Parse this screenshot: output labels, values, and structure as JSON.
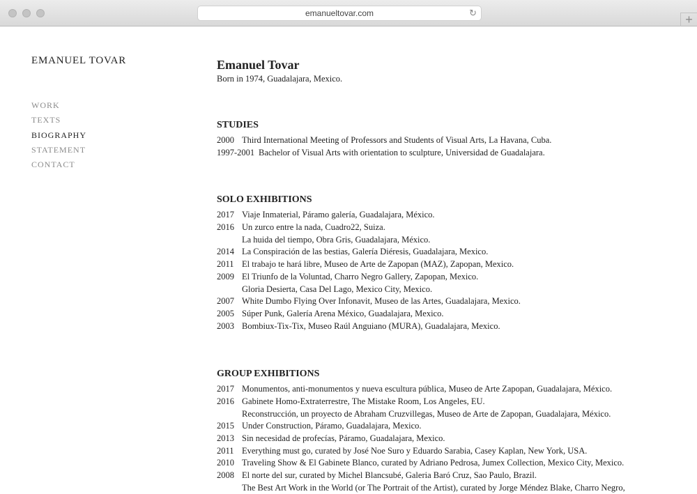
{
  "browser": {
    "url": "emanueltovar.com",
    "reload_icon": "↻",
    "new_tab_icon": "+"
  },
  "site": {
    "title": "EMANUEL TOVAR"
  },
  "nav": [
    {
      "label": "WORK",
      "active": false
    },
    {
      "label": "TEXTS",
      "active": false
    },
    {
      "label": "BIOGRAPHY",
      "active": true
    },
    {
      "label": "STATEMENT",
      "active": false
    },
    {
      "label": "CONTACT",
      "active": false
    }
  ],
  "bio": {
    "name": "Emanuel Tovar",
    "born": "Born in 1974, Guadalajara, Mexico."
  },
  "studies": {
    "title": "STUDIES",
    "entries": [
      {
        "year": "2000",
        "text": "Third International Meeting of Professors and Students of Visual Arts, La Havana, Cuba."
      },
      {
        "year": "1997-2001",
        "text": "Bachelor of Visual Arts with orientation to sculpture, Universidad de Guadalajara."
      }
    ]
  },
  "solo": {
    "title": "SOLO EXHIBITIONS",
    "entries": [
      {
        "year": "2017",
        "text": "Viaje Inmaterial, Páramo galería, Guadalajara, México."
      },
      {
        "year": "2016",
        "text": "Un zurco entre la nada, Cuadro22, Suiza."
      },
      {
        "year": "",
        "text": "La huida del tiempo, Obra Gris, Guadalajara, México."
      },
      {
        "year": "2014",
        "text": "La Conspiración de las bestias, Galería Diéresis, Guadalajara, Mexico."
      },
      {
        "year": "2011",
        "text": "El trabajo te hará libre, Museo de Arte de Zapopan (MAZ), Zapopan, Mexico."
      },
      {
        "year": "2009",
        "text": "El Triunfo de la Voluntad, Charro Negro Gallery, Zapopan, Mexico."
      },
      {
        "year": "",
        "text": "Gloria Desierta, Casa Del Lago, Mexico City, Mexico."
      },
      {
        "year": "2007",
        "text": "White Dumbo Flying Over Infonavit, Museo de las Artes, Guadalajara, Mexico."
      },
      {
        "year": "2005",
        "text": "Súper Punk, Galería Arena México, Guadalajara, Mexico."
      },
      {
        "year": "2003",
        "text": "Bombiux-Tix-Tix, Museo Raúl Anguiano (MURA), Guadalajara, Mexico."
      }
    ]
  },
  "group": {
    "title": "GROUP EXHIBITIONS",
    "entries": [
      {
        "year": "2017",
        "text": "Monumentos, anti-monumentos y nueva escultura pública, Museo de Arte Zapopan, Guadalajara, México."
      },
      {
        "year": "2016",
        "text": "Gabinete Homo-Extraterrestre, The Mistake Room, Los Angeles, EU."
      },
      {
        "year": "",
        "text": "Reconstrucción, un proyecto de Abraham Cruzvillegas, Museo de Arte de Zapopan, Guadalajara, México."
      },
      {
        "year": "2015",
        "text": "Under Construction, Páramo, Guadalajara, Mexico."
      },
      {
        "year": "2013",
        "text": "Sin necesidad de profecías, Páramo, Guadalajara, Mexico."
      },
      {
        "year": "2011",
        "text": "Everything must go, curated by José Noe Suro y Eduardo Sarabia, Casey Kaplan, New York, USA."
      },
      {
        "year": "2010",
        "text": "Traveling Show & El Gabinete Blanco, curated by Adriano Pedrosa, Jumex Collection, Mexico City, Mexico."
      },
      {
        "year": "2008",
        "text": "El norte del sur, curated by Michel Blancsubé, Galeria Baró Cruz, Sao Paulo, Brazil."
      },
      {
        "year": "",
        "text": "The Best Art Work in the World (or The Portrait of the Artist), curated by Jorge Méndez Blake, Charro Negro,"
      }
    ]
  }
}
